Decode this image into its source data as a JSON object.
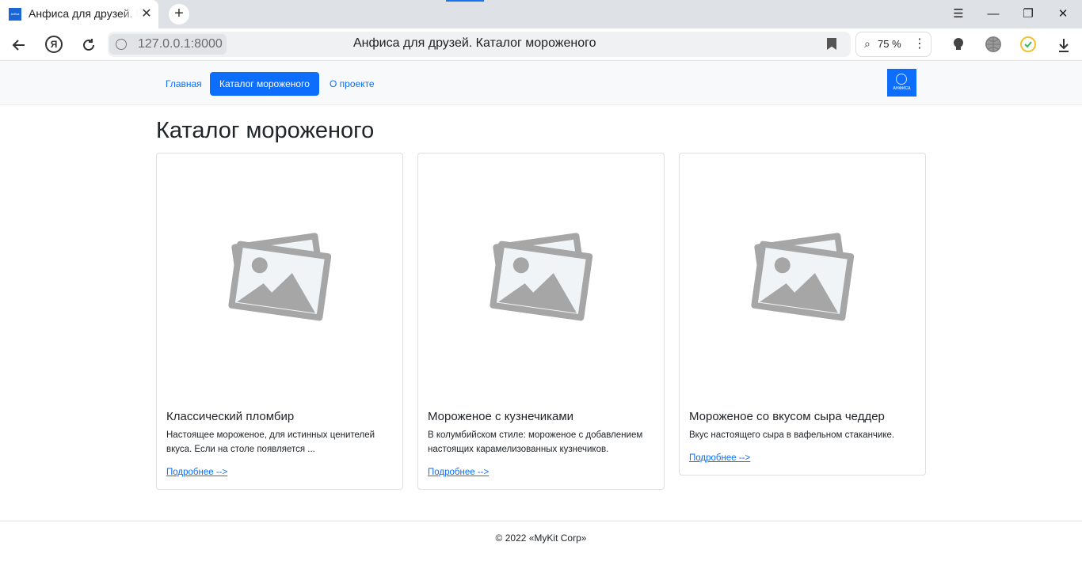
{
  "browser": {
    "tab_title": "Анфиса для друзей. Каталог мороженого",
    "tab_favicon_text": "anfisa",
    "tab_close": "✕",
    "new_tab": "+",
    "window_controls": {
      "menu": "☰",
      "minimize": "—",
      "restore": "❐",
      "close": "✕"
    },
    "url": "127.0.0.1:8000",
    "page_title": "Анфиса для друзей. Каталог мороженого",
    "zoom": "75 %",
    "icons": [
      "back-arrow-icon",
      "yandex-icon",
      "reload-icon",
      "site-info-icon",
      "bookmark-icon",
      "search-zoom-icon",
      "menu-dots-icon",
      "lightbulb-icon",
      "globe-icon",
      "timer-icon",
      "download-icon"
    ]
  },
  "navbar": {
    "items": [
      {
        "label": "Главная",
        "active": false
      },
      {
        "label": "Каталог мороженого",
        "active": true
      },
      {
        "label": "О проекте",
        "active": false
      }
    ],
    "logo_text": "АНФИСА"
  },
  "page": {
    "heading": "Каталог мороженого"
  },
  "cards": [
    {
      "title": "Классический пломбир",
      "text": "Настоящее мороженое, для истинных ценителей вкуса. Если на столе появляется ...",
      "link": "Подробнее -->"
    },
    {
      "title": "Мороженое с кузнечиками",
      "text": "В колумбийском стиле: мороженое с добавлением настоящих карамелизованных кузнечиков.",
      "link": "Подробнее -->"
    },
    {
      "title": "Мороженое со вкусом сыра чеддер",
      "text": "Вкус настоящего сыра в вафельном стаканчике.",
      "link": "Подробнее -->"
    }
  ],
  "footer": {
    "text": "© 2022 «MyKit Corp»"
  },
  "colors": {
    "primary": "#0d6efd",
    "navbar_bg": "#f8f9fa",
    "placeholder_gray": "#a6a6a6",
    "placeholder_fill": "#f1f4f6"
  }
}
